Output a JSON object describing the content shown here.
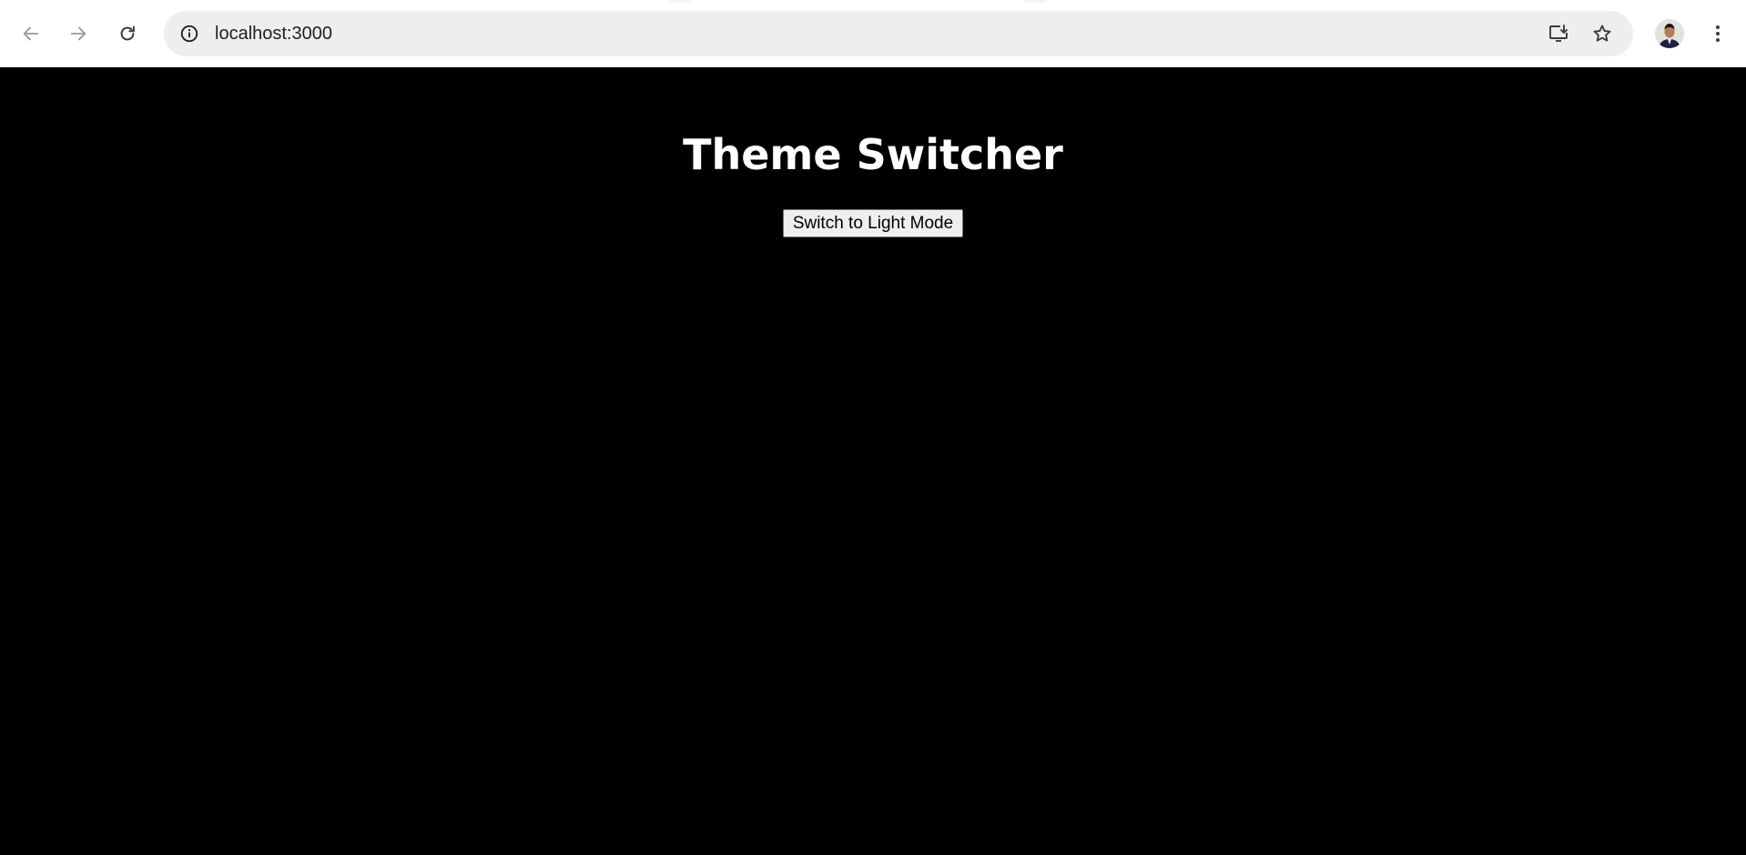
{
  "browser": {
    "url": "localhost:3000",
    "icons": {
      "back": "arrow-left-icon",
      "forward": "arrow-right-icon",
      "reload": "reload-icon",
      "site_info": "info-icon",
      "install": "install-app-icon",
      "bookmark": "star-icon",
      "profile": "profile-avatar",
      "menu": "kebab-menu-icon"
    }
  },
  "page": {
    "title": "Theme Switcher",
    "toggle_label": "Switch to Light Mode",
    "background_color": "#000000",
    "text_color": "#ffffff"
  }
}
